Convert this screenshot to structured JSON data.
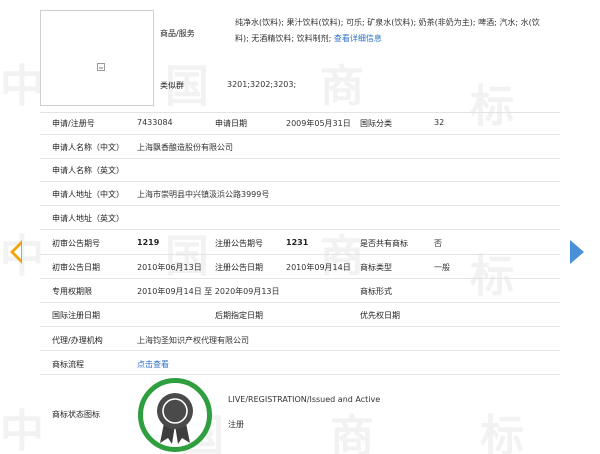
{
  "watermarks": [
    "中",
    "国",
    "商",
    "标",
    "中",
    "国",
    "商",
    "标",
    "中",
    "国",
    "商",
    "标"
  ],
  "goods": {
    "label": "商品/服务",
    "text": "纯净水(饮料); 果汁饮料(饮料); 可乐; 矿泉水(饮料); 奶茶(非奶为主); 啤酒; 汽水; 水(饮料); 无酒精饮料; 饮料制剂;",
    "link": "查看详细信息"
  },
  "similar_group": {
    "label": "类似群",
    "value": "3201;3202;3203;"
  },
  "fields": {
    "reg_no_label": "申请/注册号",
    "reg_no": "7433084",
    "apply_date_label": "申请日期",
    "apply_date": "2009年05月31日",
    "intl_class_label": "国际分类",
    "intl_class": "32",
    "applicant_cn_label": "申请人名称（中文）",
    "applicant_cn": "上海飘香酿造股份有限公司",
    "applicant_en_label": "申请人名称（英文）",
    "address_cn_label": "申请人地址（中文）",
    "address_cn": "上海市崇明县中兴镇汲浜公路3999号",
    "address_en_label": "申请人地址（英文）",
    "prelim_no_label": "初审公告期号",
    "prelim_no": "1219",
    "reg_pub_no_label": "注册公告期号",
    "reg_pub_no": "1231",
    "shared_label": "是否共有商标",
    "shared": "否",
    "prelim_date_label": "初审公告日期",
    "prelim_date": "2010年06月13日",
    "reg_pub_date_label": "注册公告日期",
    "reg_pub_date": "2010年09月14日",
    "type_label": "商标类型",
    "type": "一般",
    "exclusive_label": "专用权期限",
    "exclusive": "2010年09月14日 至 2020年09月13日",
    "form_label": "商标形式",
    "intl_reg_date_label": "国际注册日期",
    "later_date_label": "后期指定日期",
    "priority_date_label": "优先权日期",
    "agent_label": "代理/办理机构",
    "agent": "上海钧圣知识产权代理有限公司",
    "process_label": "商标流程",
    "process_link": "点击查看",
    "status_label": "商标状态图标",
    "status_en": "LIVE/REGISTRATION/Issued and Active",
    "status_cn": "注册"
  },
  "colors": {
    "link": "#2a6fc9",
    "badge_green": "#2e9e3e",
    "arrow_left": "#f0a30a",
    "arrow_right": "#4a90d9"
  },
  "icons": {
    "thumb": "broken-image-icon",
    "prev": "arrow-left-icon",
    "next": "arrow-right-icon",
    "status": "award-ribbon-icon"
  }
}
